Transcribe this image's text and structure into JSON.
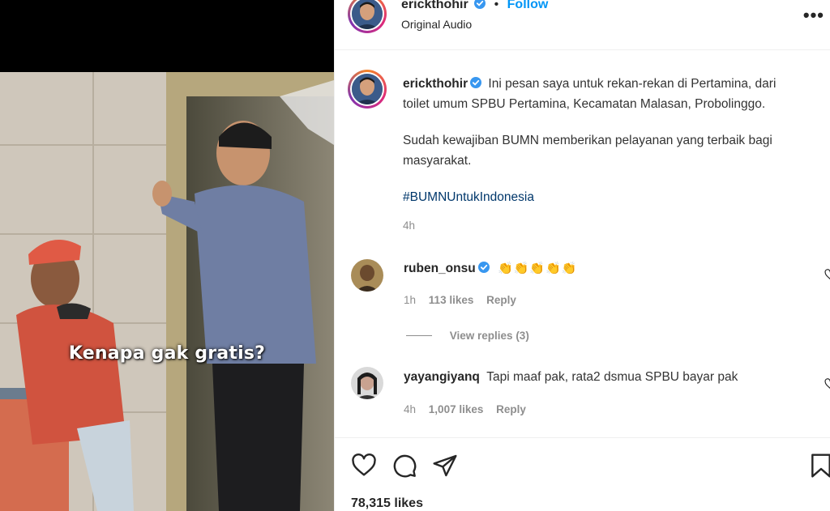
{
  "media": {
    "overlay_caption": "Kenapa gak gratis?"
  },
  "header": {
    "username": "erickthohir",
    "separator": "•",
    "follow_label": "Follow",
    "audio_label": "Original Audio",
    "more_label": "•••"
  },
  "post": {
    "username": "erickthohir",
    "caption_line1": "Ini pesan saya untuk rekan-rekan di Pertamina, dari",
    "caption_line2": "toilet umum SPBU Pertamina, Kecamatan Malasan, Probolinggo.",
    "caption_para2_line1": "Sudah kewajiban BUMN memberikan pelayanan yang terbaik bagi",
    "caption_para2_line2": "masyarakat.",
    "hashtag": "#BUMNUntukIndonesia",
    "time": "4h"
  },
  "comments": [
    {
      "username": "ruben_onsu",
      "text": "👏👏👏👏👏",
      "time": "1h",
      "likes": "113 likes",
      "reply_label": "Reply",
      "view_replies": "View replies (3)"
    },
    {
      "username": "yayangiyanq",
      "text": "Tapi maaf pak, rata2 dsmua SPBU bayar pak",
      "time": "4h",
      "likes": "1,007 likes",
      "reply_label": "Reply"
    }
  ],
  "footer": {
    "likes": "78,315 likes"
  },
  "colors": {
    "link": "#0095f6",
    "hashtag": "#00376b",
    "muted": "#8e8e8e",
    "verified": "#3897f0"
  }
}
